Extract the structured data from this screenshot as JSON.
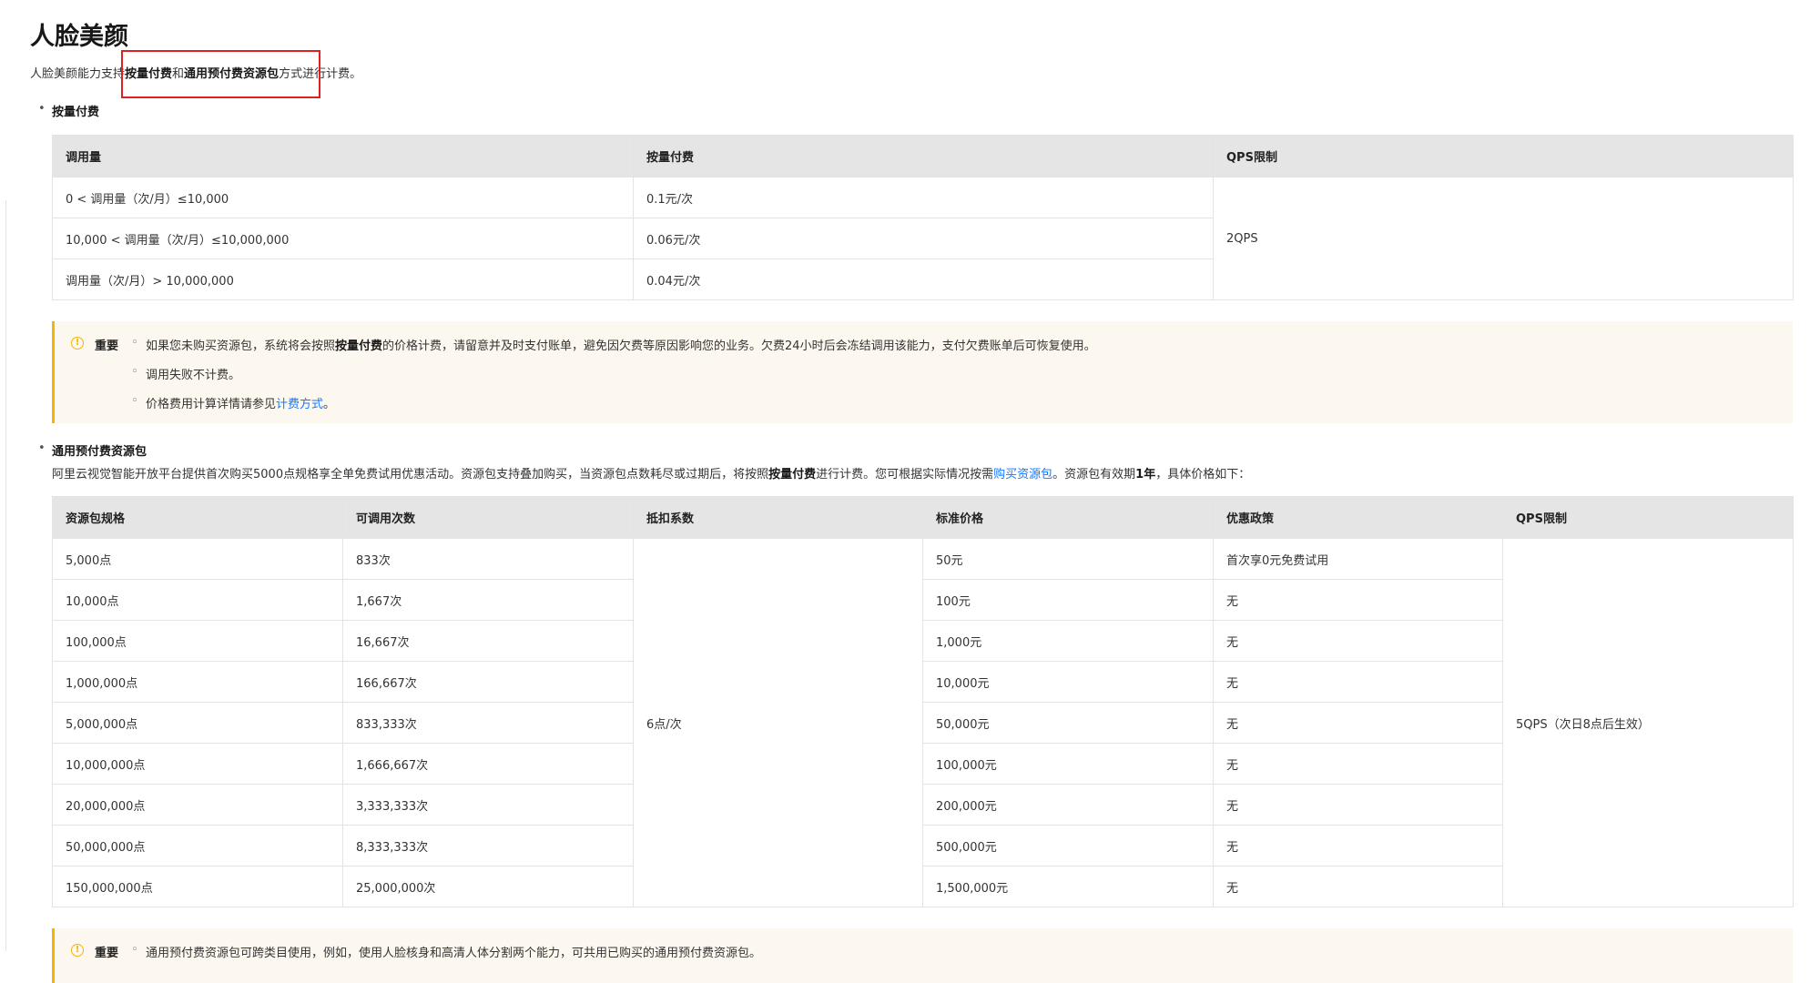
{
  "page_title": "人脸美颜",
  "intro": {
    "prefix": "人脸美颜能力支持",
    "bold1": "按量付费",
    "mid": "和",
    "bold2": "通用预付费资源包",
    "suffix": "方式进行计费。"
  },
  "section1": {
    "title": "按量付费",
    "headers": [
      "调用量",
      "按量付费",
      "QPS限制"
    ],
    "rows": [
      {
        "usage": "0 < 调用量（次/月）≤10,000",
        "price": "0.1元/次"
      },
      {
        "usage": "10,000 < 调用量（次/月）≤10,000,000",
        "price": "0.06元/次"
      },
      {
        "usage": "调用量（次/月）> 10,000,000",
        "price": "0.04元/次"
      }
    ],
    "qps": "2QPS"
  },
  "notice1": {
    "icon": "info-icon",
    "label": "重要",
    "item1": {
      "pre": "如果您未购买资源包，系统将会按照",
      "bold": "按量付费",
      "post": "的价格计费，请留意并及时支付账单，避免因欠费等原因影响您的业务。欠费24小时后会冻结调用该能力，支付欠费账单后可恢复使用。"
    },
    "item2": "调用失败不计费。",
    "item3": {
      "pre": "价格费用计算详情请参见",
      "link": "计费方式",
      "post": "。"
    }
  },
  "section2": {
    "title": "通用预付费资源包",
    "para": {
      "p1": "阿里云视觉智能开放平台提供首次购买5000点规格享全单免费试用优惠活动。资源包支持叠加购买，当资源包点数耗尽或过期后，将按照",
      "b1": "按量付费",
      "p2": "进行计费。您可根据实际情况按需",
      "link": "购买资源包",
      "p3": "。资源包有效期",
      "b2": "1年",
      "p4": "，具体价格如下："
    },
    "headers": [
      "资源包规格",
      "可调用次数",
      "抵扣系数",
      "标准价格",
      "优惠政策",
      "QPS限制"
    ],
    "rows": [
      {
        "spec": "5,000点",
        "count": "833次",
        "price": "50元",
        "policy": "首次享0元免费试用"
      },
      {
        "spec": "10,000点",
        "count": "1,667次",
        "price": "100元",
        "policy": "无"
      },
      {
        "spec": "100,000点",
        "count": "16,667次",
        "price": "1,000元",
        "policy": "无"
      },
      {
        "spec": "1,000,000点",
        "count": "166,667次",
        "price": "10,000元",
        "policy": "无"
      },
      {
        "spec": "5,000,000点",
        "count": "833,333次",
        "price": "50,000元",
        "policy": "无"
      },
      {
        "spec": "10,000,000点",
        "count": "1,666,667次",
        "price": "100,000元",
        "policy": "无"
      },
      {
        "spec": "20,000,000点",
        "count": "3,333,333次",
        "price": "200,000元",
        "policy": "无"
      },
      {
        "spec": "50,000,000点",
        "count": "8,333,333次",
        "price": "500,000元",
        "policy": "无"
      },
      {
        "spec": "150,000,000点",
        "count": "25,000,000次",
        "price": "1,500,000元",
        "policy": "无"
      }
    ],
    "deduction": "6点/次",
    "qps": "5QPS（次日8点后生效）"
  },
  "notice2": {
    "icon": "info-icon",
    "label": "重要",
    "item1": "通用预付费资源包可跨类目使用，例如，使用人脸核身和高清人体分割两个能力，可共用已购买的通用预付费资源包。"
  }
}
